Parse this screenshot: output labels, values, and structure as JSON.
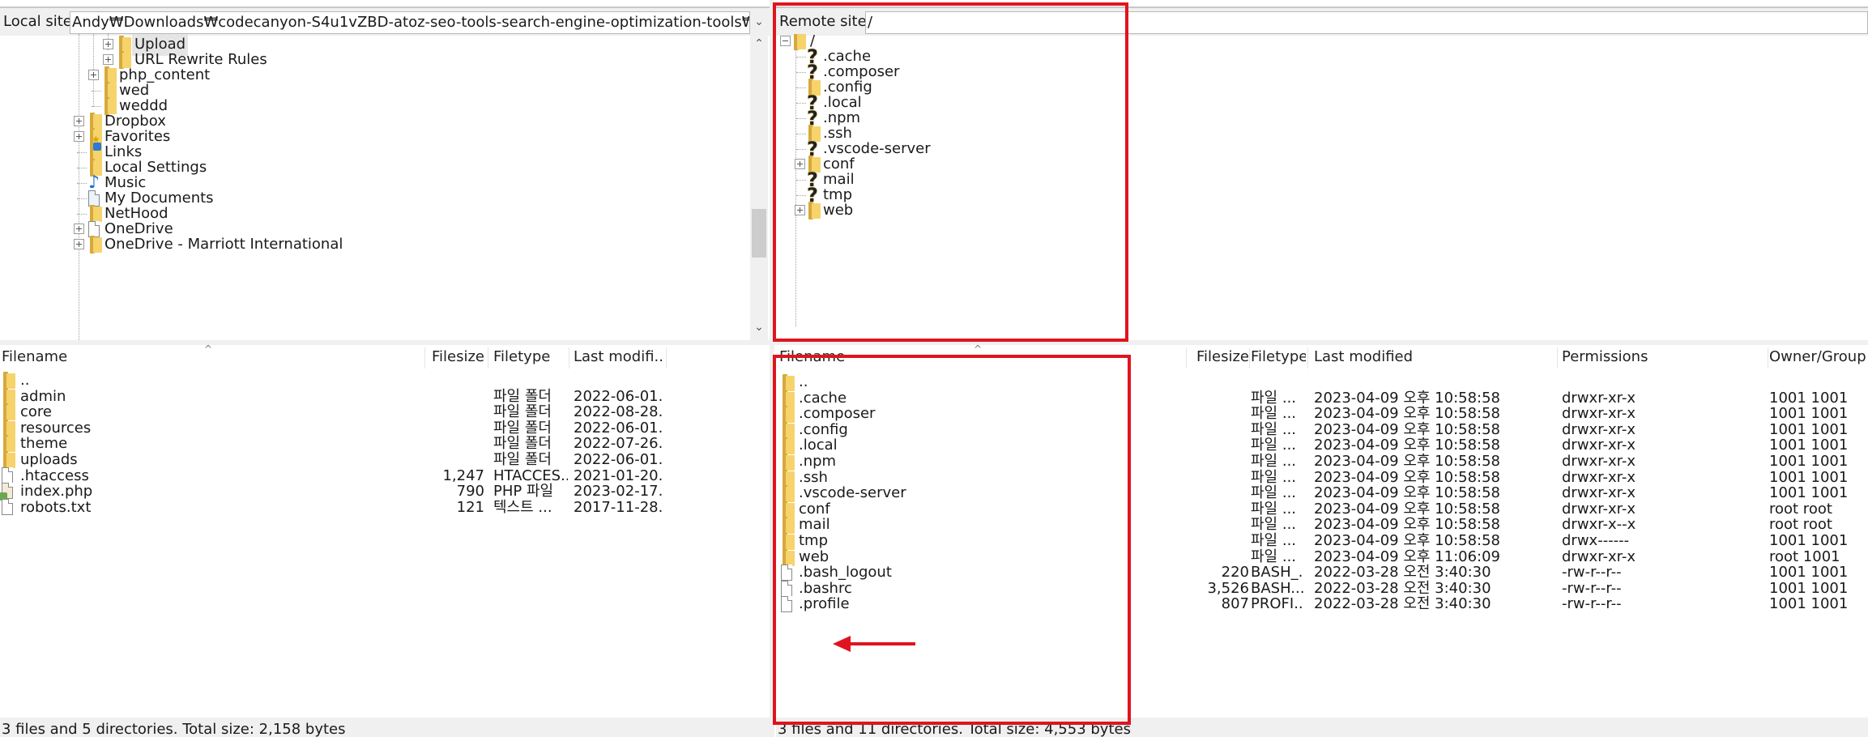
{
  "local": {
    "site_label": "Local site:",
    "site_path": "Andy₩Downloads₩codecanyon-S4u1vZBD-atoz-seo-tools-search-engine-optimization-tools₩Upload₩",
    "tree": [
      {
        "label": "Upload",
        "icon": "folder-icon",
        "expander": "plus"
      },
      {
        "label": "URL Rewrite Rules",
        "icon": "folder-icon",
        "expander": "plus"
      },
      {
        "label": "php_content",
        "icon": "folder-icon",
        "expander": "plus"
      },
      {
        "label": "wed",
        "icon": "folder-icon",
        "expander": "none"
      },
      {
        "label": "weddd",
        "icon": "folder-icon",
        "expander": "none"
      },
      {
        "label": "Dropbox",
        "icon": "folder-icon",
        "expander": "plus"
      },
      {
        "label": "Favorites",
        "icon": "favorites-folder-icon",
        "expander": "plus"
      },
      {
        "label": "Links",
        "icon": "links-folder-icon",
        "expander": "none"
      },
      {
        "label": "Local Settings",
        "icon": "folder-icon",
        "expander": "none"
      },
      {
        "label": "Music",
        "icon": "music-note-icon",
        "expander": "none"
      },
      {
        "label": "My Documents",
        "icon": "documents-icon",
        "expander": "none"
      },
      {
        "label": "NetHood",
        "icon": "folder-icon",
        "expander": "none"
      },
      {
        "label": "OneDrive",
        "icon": "file-icon",
        "expander": "plus"
      },
      {
        "label": "OneDrive - Marriott International",
        "icon": "folder-icon",
        "expander": "plus"
      }
    ],
    "headers": {
      "filename": "Filename",
      "filesize": "Filesize",
      "filetype": "Filetype",
      "modified": "Last modifi..."
    },
    "files": [
      {
        "name": "..",
        "size": "",
        "type": "",
        "modified": "",
        "icon": "folder-icon"
      },
      {
        "name": "admin",
        "size": "",
        "type": "파일 폴더",
        "modified": "2022-06-01...",
        "icon": "folder-icon"
      },
      {
        "name": "core",
        "size": "",
        "type": "파일 폴더",
        "modified": "2022-08-28...",
        "icon": "folder-icon"
      },
      {
        "name": "resources",
        "size": "",
        "type": "파일 폴더",
        "modified": "2022-06-01...",
        "icon": "folder-icon"
      },
      {
        "name": "theme",
        "size": "",
        "type": "파일 폴더",
        "modified": "2022-07-26...",
        "icon": "folder-icon"
      },
      {
        "name": "uploads",
        "size": "",
        "type": "파일 폴더",
        "modified": "2022-06-01...",
        "icon": "folder-icon"
      },
      {
        "name": ".htaccess",
        "size": "1,247",
        "type": "HTACCES...",
        "modified": "2021-01-20...",
        "icon": "file-icon"
      },
      {
        "name": "index.php",
        "size": "790",
        "type": "PHP 파일",
        "modified": "2023-02-17...",
        "icon": "php-file-icon"
      },
      {
        "name": "robots.txt",
        "size": "121",
        "type": "텍스트 ...",
        "modified": "2017-11-28...",
        "icon": "text-file-icon"
      }
    ],
    "status": "3 files and 5 directories. Total size: 2,158 bytes"
  },
  "remote": {
    "site_label": "Remote site:",
    "site_path": "/",
    "tree_root": "/",
    "tree": [
      {
        "label": ".cache",
        "icon": "unknown-folder-icon",
        "expander": "none"
      },
      {
        "label": ".composer",
        "icon": "unknown-folder-icon",
        "expander": "none"
      },
      {
        "label": ".config",
        "icon": "folder-icon",
        "expander": "none"
      },
      {
        "label": ".local",
        "icon": "unknown-folder-icon",
        "expander": "none"
      },
      {
        "label": ".npm",
        "icon": "unknown-folder-icon",
        "expander": "none"
      },
      {
        "label": ".ssh",
        "icon": "folder-icon",
        "expander": "none"
      },
      {
        "label": ".vscode-server",
        "icon": "unknown-folder-icon",
        "expander": "none"
      },
      {
        "label": "conf",
        "icon": "folder-icon",
        "expander": "plus"
      },
      {
        "label": "mail",
        "icon": "unknown-folder-icon",
        "expander": "none"
      },
      {
        "label": "tmp",
        "icon": "unknown-folder-icon",
        "expander": "none"
      },
      {
        "label": "web",
        "icon": "folder-icon",
        "expander": "plus"
      }
    ],
    "headers": {
      "filename": "Filename",
      "filesize": "Filesize",
      "filetype": "Filetype",
      "modified": "Last modified",
      "permissions": "Permissions",
      "owner": "Owner/Group"
    },
    "files": [
      {
        "name": "..",
        "size": "",
        "type": "",
        "modified": "",
        "perms": "",
        "owner": "",
        "icon": "folder-icon"
      },
      {
        "name": ".cache",
        "size": "",
        "type": "파일 ...",
        "modified": "2023-04-09 오후 10:58:58",
        "perms": "drwxr-xr-x",
        "owner": "1001 1001",
        "icon": "folder-icon"
      },
      {
        "name": ".composer",
        "size": "",
        "type": "파일 ...",
        "modified": "2023-04-09 오후 10:58:58",
        "perms": "drwxr-xr-x",
        "owner": "1001 1001",
        "icon": "folder-icon"
      },
      {
        "name": ".config",
        "size": "",
        "type": "파일 ...",
        "modified": "2023-04-09 오후 10:58:58",
        "perms": "drwxr-xr-x",
        "owner": "1001 1001",
        "icon": "folder-icon"
      },
      {
        "name": ".local",
        "size": "",
        "type": "파일 ...",
        "modified": "2023-04-09 오후 10:58:58",
        "perms": "drwxr-xr-x",
        "owner": "1001 1001",
        "icon": "folder-icon"
      },
      {
        "name": ".npm",
        "size": "",
        "type": "파일 ...",
        "modified": "2023-04-09 오후 10:58:58",
        "perms": "drwxr-xr-x",
        "owner": "1001 1001",
        "icon": "folder-icon"
      },
      {
        "name": ".ssh",
        "size": "",
        "type": "파일 ...",
        "modified": "2023-04-09 오후 10:58:58",
        "perms": "drwxr-xr-x",
        "owner": "1001 1001",
        "icon": "folder-icon"
      },
      {
        "name": ".vscode-server",
        "size": "",
        "type": "파일 ...",
        "modified": "2023-04-09 오후 10:58:58",
        "perms": "drwxr-xr-x",
        "owner": "1001 1001",
        "icon": "folder-icon"
      },
      {
        "name": "conf",
        "size": "",
        "type": "파일 ...",
        "modified": "2023-04-09 오후 10:58:58",
        "perms": "drwxr-xr-x",
        "owner": "root root",
        "icon": "folder-icon"
      },
      {
        "name": "mail",
        "size": "",
        "type": "파일 ...",
        "modified": "2023-04-09 오후 10:58:58",
        "perms": "drwxr-x--x",
        "owner": "root root",
        "icon": "folder-icon"
      },
      {
        "name": "tmp",
        "size": "",
        "type": "파일 ...",
        "modified": "2023-04-09 오후 10:58:58",
        "perms": "drwx------",
        "owner": "1001 1001",
        "icon": "folder-icon"
      },
      {
        "name": "web",
        "size": "",
        "type": "파일 ...",
        "modified": "2023-04-09 오후 11:06:09",
        "perms": "drwxr-xr-x",
        "owner": "root 1001",
        "icon": "folder-icon"
      },
      {
        "name": ".bash_logout",
        "size": "220",
        "type": "BASH_...",
        "modified": "2022-03-28 오전 3:40:30",
        "perms": "-rw-r--r--",
        "owner": "1001 1001",
        "icon": "file-icon"
      },
      {
        "name": ".bashrc",
        "size": "3,526",
        "type": "BASH...",
        "modified": "2022-03-28 오전 3:40:30",
        "perms": "-rw-r--r--",
        "owner": "1001 1001",
        "icon": "file-icon"
      },
      {
        "name": ".profile",
        "size": "807",
        "type": "PROFI...",
        "modified": "2022-03-28 오전 3:40:30",
        "perms": "-rw-r--r--",
        "owner": "1001 1001",
        "icon": "file-icon"
      }
    ],
    "status": "3 files and 11 directories. Total size: 4,553 bytes"
  },
  "annotation_color": "#e0141e",
  "folder_color": "#f6d36b"
}
